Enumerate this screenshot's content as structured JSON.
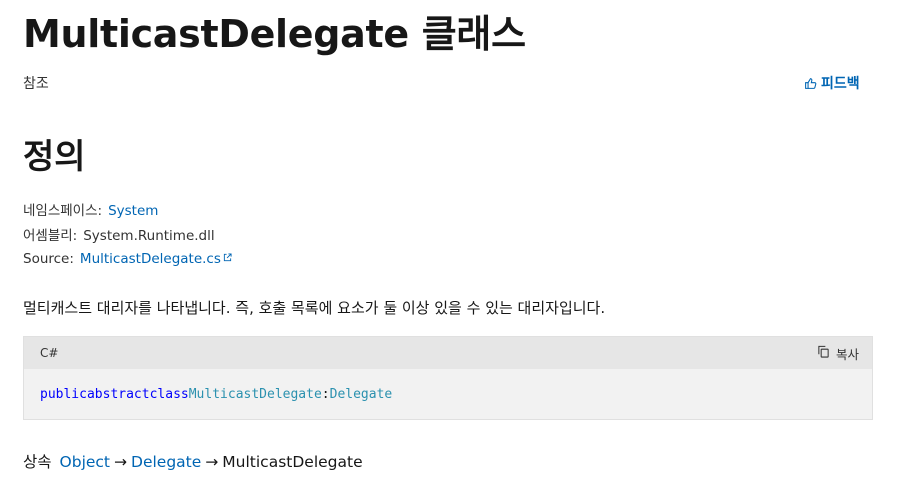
{
  "header": {
    "title": "MulticastDelegate 클래스",
    "reference_label": "참조",
    "feedback_label": "피드백"
  },
  "definition": {
    "heading": "정의",
    "namespace_label": "네임스페이스:",
    "namespace_value": "System",
    "assembly_label": "어셈블리:",
    "assembly_value": "System.Runtime.dll",
    "source_label": "Source:",
    "source_value": "MulticastDelegate.cs"
  },
  "description": "멀티캐스트 대리자를 나타냅니다. 즉, 호출 목록에 요소가 둘 이상 있을 수 있는 대리자입니다.",
  "code_block": {
    "language": "C#",
    "copy_label": "복사",
    "tokens": {
      "public": "public",
      "abstract": "abstract",
      "class": "class",
      "type_name": "MulticastDelegate",
      "colon": ":",
      "base_type": "Delegate"
    }
  },
  "inheritance": {
    "label": "상속",
    "items": [
      "Object",
      "Delegate",
      "MulticastDelegate"
    ],
    "arrow": "→"
  },
  "colors": {
    "link": "#0065b3",
    "keyword": "#0101fd",
    "type": "#2b91af",
    "code_header_bg": "#e6e6e6",
    "code_bg": "#f2f2f2"
  },
  "icons": {
    "feedback": "thumbs-up-icon",
    "external": "external-link-icon",
    "copy": "copy-icon"
  }
}
